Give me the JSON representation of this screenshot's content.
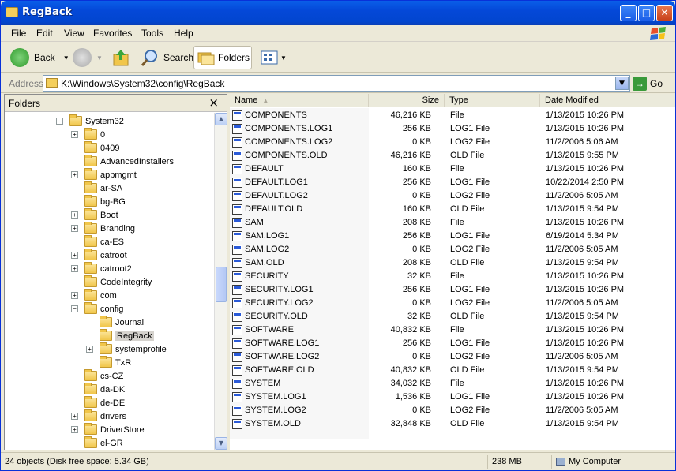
{
  "window": {
    "title": "RegBack"
  },
  "menu": [
    "File",
    "Edit",
    "View",
    "Favorites",
    "Tools",
    "Help"
  ],
  "toolbar": {
    "back": "Back",
    "search": "Search",
    "folders": "Folders"
  },
  "address": {
    "label": "Address",
    "path": "K:\\Windows\\System32\\config\\RegBack",
    "go": "Go"
  },
  "folders_pane": {
    "title": "Folders",
    "close": "×"
  },
  "tree": [
    {
      "label": "System32",
      "exp": "−",
      "indent": 0
    },
    {
      "label": "0",
      "exp": "+",
      "indent": 1
    },
    {
      "label": "0409",
      "exp": "",
      "indent": 1
    },
    {
      "label": "AdvancedInstallers",
      "exp": "",
      "indent": 1
    },
    {
      "label": "appmgmt",
      "exp": "+",
      "indent": 1
    },
    {
      "label": "ar-SA",
      "exp": "",
      "indent": 1
    },
    {
      "label": "bg-BG",
      "exp": "",
      "indent": 1
    },
    {
      "label": "Boot",
      "exp": "+",
      "indent": 1
    },
    {
      "label": "Branding",
      "exp": "+",
      "indent": 1
    },
    {
      "label": "ca-ES",
      "exp": "",
      "indent": 1
    },
    {
      "label": "catroot",
      "exp": "+",
      "indent": 1
    },
    {
      "label": "catroot2",
      "exp": "+",
      "indent": 1
    },
    {
      "label": "CodeIntegrity",
      "exp": "",
      "indent": 1
    },
    {
      "label": "com",
      "exp": "+",
      "indent": 1
    },
    {
      "label": "config",
      "exp": "−",
      "indent": 1
    },
    {
      "label": "Journal",
      "exp": "",
      "indent": 2
    },
    {
      "label": "RegBack",
      "exp": "",
      "indent": 2,
      "selected": true
    },
    {
      "label": "systemprofile",
      "exp": "+",
      "indent": 2
    },
    {
      "label": "TxR",
      "exp": "",
      "indent": 2
    },
    {
      "label": "cs-CZ",
      "exp": "",
      "indent": 1
    },
    {
      "label": "da-DK",
      "exp": "",
      "indent": 1
    },
    {
      "label": "de-DE",
      "exp": "",
      "indent": 1
    },
    {
      "label": "drivers",
      "exp": "+",
      "indent": 1
    },
    {
      "label": "DriverStore",
      "exp": "+",
      "indent": 1
    },
    {
      "label": "el-GR",
      "exp": "",
      "indent": 1
    }
  ],
  "columns": {
    "name": "Name",
    "size": "Size",
    "type": "Type",
    "date": "Date Modified"
  },
  "files": [
    {
      "name": "COMPONENTS",
      "size": "46,216 KB",
      "type": "File",
      "date": "1/13/2015 10:26 PM"
    },
    {
      "name": "COMPONENTS.LOG1",
      "size": "256 KB",
      "type": "LOG1 File",
      "date": "1/13/2015 10:26 PM"
    },
    {
      "name": "COMPONENTS.LOG2",
      "size": "0 KB",
      "type": "LOG2 File",
      "date": "11/2/2006 5:06 AM"
    },
    {
      "name": "COMPONENTS.OLD",
      "size": "46,216 KB",
      "type": "OLD File",
      "date": "1/13/2015 9:55 PM"
    },
    {
      "name": "DEFAULT",
      "size": "160 KB",
      "type": "File",
      "date": "1/13/2015 10:26 PM"
    },
    {
      "name": "DEFAULT.LOG1",
      "size": "256 KB",
      "type": "LOG1 File",
      "date": "10/22/2014 2:50 PM"
    },
    {
      "name": "DEFAULT.LOG2",
      "size": "0 KB",
      "type": "LOG2 File",
      "date": "11/2/2006 5:05 AM"
    },
    {
      "name": "DEFAULT.OLD",
      "size": "160 KB",
      "type": "OLD File",
      "date": "1/13/2015 9:54 PM"
    },
    {
      "name": "SAM",
      "size": "208 KB",
      "type": "File",
      "date": "1/13/2015 10:26 PM"
    },
    {
      "name": "SAM.LOG1",
      "size": "256 KB",
      "type": "LOG1 File",
      "date": "6/19/2014 5:34 PM"
    },
    {
      "name": "SAM.LOG2",
      "size": "0 KB",
      "type": "LOG2 File",
      "date": "11/2/2006 5:05 AM"
    },
    {
      "name": "SAM.OLD",
      "size": "208 KB",
      "type": "OLD File",
      "date": "1/13/2015 9:54 PM"
    },
    {
      "name": "SECURITY",
      "size": "32 KB",
      "type": "File",
      "date": "1/13/2015 10:26 PM"
    },
    {
      "name": "SECURITY.LOG1",
      "size": "256 KB",
      "type": "LOG1 File",
      "date": "1/13/2015 10:26 PM"
    },
    {
      "name": "SECURITY.LOG2",
      "size": "0 KB",
      "type": "LOG2 File",
      "date": "11/2/2006 5:05 AM"
    },
    {
      "name": "SECURITY.OLD",
      "size": "32 KB",
      "type": "OLD File",
      "date": "1/13/2015 9:54 PM"
    },
    {
      "name": "SOFTWARE",
      "size": "40,832 KB",
      "type": "File",
      "date": "1/13/2015 10:26 PM"
    },
    {
      "name": "SOFTWARE.LOG1",
      "size": "256 KB",
      "type": "LOG1 File",
      "date": "1/13/2015 10:26 PM"
    },
    {
      "name": "SOFTWARE.LOG2",
      "size": "0 KB",
      "type": "LOG2 File",
      "date": "11/2/2006 5:05 AM"
    },
    {
      "name": "SOFTWARE.OLD",
      "size": "40,832 KB",
      "type": "OLD File",
      "date": "1/13/2015 9:54 PM"
    },
    {
      "name": "SYSTEM",
      "size": "34,032 KB",
      "type": "File",
      "date": "1/13/2015 10:26 PM"
    },
    {
      "name": "SYSTEM.LOG1",
      "size": "1,536 KB",
      "type": "LOG1 File",
      "date": "1/13/2015 10:26 PM"
    },
    {
      "name": "SYSTEM.LOG2",
      "size": "0 KB",
      "type": "LOG2 File",
      "date": "11/2/2006 5:05 AM"
    },
    {
      "name": "SYSTEM.OLD",
      "size": "32,848 KB",
      "type": "OLD File",
      "date": "1/13/2015 9:54 PM"
    }
  ],
  "status": {
    "objects": "24 objects (Disk free space: 5.34 GB)",
    "size": "238 MB",
    "location": "My Computer"
  }
}
